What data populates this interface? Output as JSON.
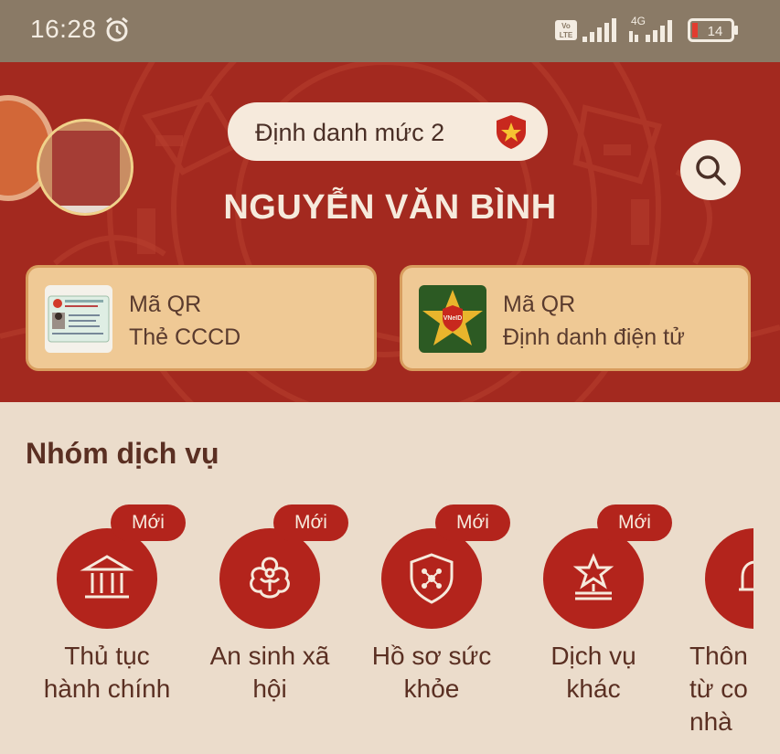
{
  "status_bar": {
    "time": "16:28",
    "network_type": "4G",
    "volte": "Vo LTE",
    "battery_level": "14"
  },
  "header": {
    "identity_level": "Định danh mức 2",
    "user_name": "NGUYỄN VĂN BÌNH",
    "qr_cards": [
      {
        "line1": "Mã QR",
        "line2": "Thẻ CCCD"
      },
      {
        "line1": "Mã QR",
        "line2": "Định danh điện tử"
      }
    ]
  },
  "services": {
    "title": "Nhóm dịch vụ",
    "new_badge": "Mới",
    "items": [
      {
        "label_lines": [
          "Thủ tục",
          "hành chính"
        ],
        "icon": "government-building-icon",
        "is_new": true
      },
      {
        "label_lines": [
          "An sinh xã",
          "hội"
        ],
        "icon": "social-welfare-icon",
        "is_new": true
      },
      {
        "label_lines": [
          "Hồ sơ sức",
          "khỏe"
        ],
        "icon": "health-shield-icon",
        "is_new": true
      },
      {
        "label_lines": [
          "Dịch vụ",
          "khác"
        ],
        "icon": "star-podium-icon",
        "is_new": true
      },
      {
        "label_lines": [
          "Thôn",
          "từ co",
          "nhà"
        ],
        "icon": "bell-icon",
        "is_new": false
      }
    ]
  },
  "colors": {
    "header_red": "#a3291f",
    "accent_red": "#b3241c",
    "cream": "#f6eadc",
    "card_gold": "#efc995",
    "page_bg": "#ebdccb",
    "status_bar": "#8a7a66"
  }
}
